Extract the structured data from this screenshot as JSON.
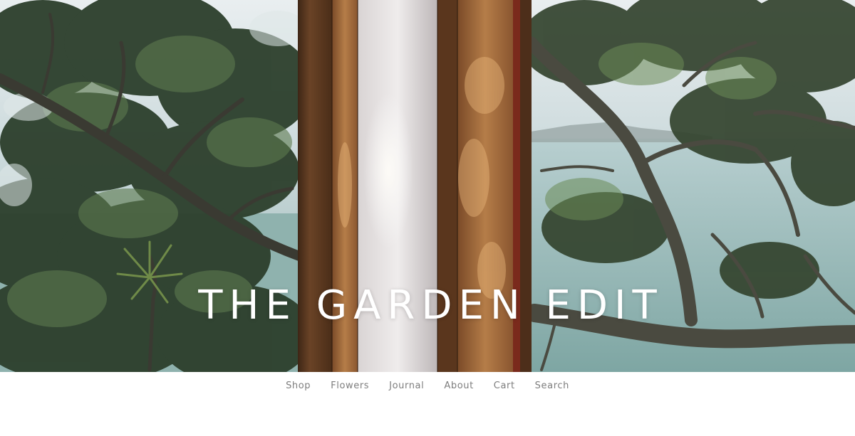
{
  "hero": {
    "title": "THE GARDEN EDIT",
    "image_description": "hero-photo"
  },
  "nav": {
    "items": [
      {
        "label": "Shop"
      },
      {
        "label": "Flowers"
      },
      {
        "label": "Journal"
      },
      {
        "label": "About"
      },
      {
        "label": "Cart"
      },
      {
        "label": "Search"
      }
    ]
  },
  "colors": {
    "nav_text": "#7d7d7d",
    "title_text": "#ffffff",
    "background": "#ffffff"
  }
}
